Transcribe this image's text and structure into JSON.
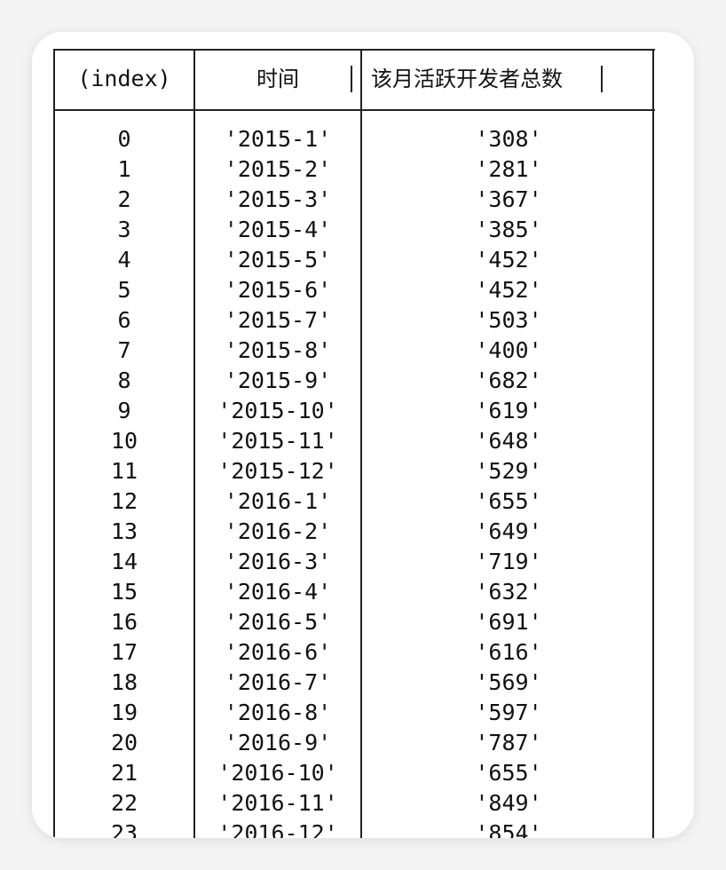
{
  "table": {
    "columns": [
      "(index)",
      "时间",
      "该月活跃开发者总数"
    ],
    "rows": [
      {
        "index": "0",
        "time": "'2015-1'",
        "count": "'308'"
      },
      {
        "index": "1",
        "time": "'2015-2'",
        "count": "'281'"
      },
      {
        "index": "2",
        "time": "'2015-3'",
        "count": "'367'"
      },
      {
        "index": "3",
        "time": "'2015-4'",
        "count": "'385'"
      },
      {
        "index": "4",
        "time": "'2015-5'",
        "count": "'452'"
      },
      {
        "index": "5",
        "time": "'2015-6'",
        "count": "'452'"
      },
      {
        "index": "6",
        "time": "'2015-7'",
        "count": "'503'"
      },
      {
        "index": "7",
        "time": "'2015-8'",
        "count": "'400'"
      },
      {
        "index": "8",
        "time": "'2015-9'",
        "count": "'682'"
      },
      {
        "index": "9",
        "time": "'2015-10'",
        "count": "'619'"
      },
      {
        "index": "10",
        "time": "'2015-11'",
        "count": "'648'"
      },
      {
        "index": "11",
        "time": "'2015-12'",
        "count": "'529'"
      },
      {
        "index": "12",
        "time": "'2016-1'",
        "count": "'655'"
      },
      {
        "index": "13",
        "time": "'2016-2'",
        "count": "'649'"
      },
      {
        "index": "14",
        "time": "'2016-3'",
        "count": "'719'"
      },
      {
        "index": "15",
        "time": "'2016-4'",
        "count": "'632'"
      },
      {
        "index": "16",
        "time": "'2016-5'",
        "count": "'691'"
      },
      {
        "index": "17",
        "time": "'2016-6'",
        "count": "'616'"
      },
      {
        "index": "18",
        "time": "'2016-7'",
        "count": "'569'"
      },
      {
        "index": "19",
        "time": "'2016-8'",
        "count": "'597'"
      },
      {
        "index": "20",
        "time": "'2016-9'",
        "count": "'787'"
      },
      {
        "index": "21",
        "time": "'2016-10'",
        "count": "'655'"
      },
      {
        "index": "22",
        "time": "'2016-11'",
        "count": "'849'"
      },
      {
        "index": "23",
        "time": "'2016-12'",
        "count": "'854'"
      }
    ]
  }
}
